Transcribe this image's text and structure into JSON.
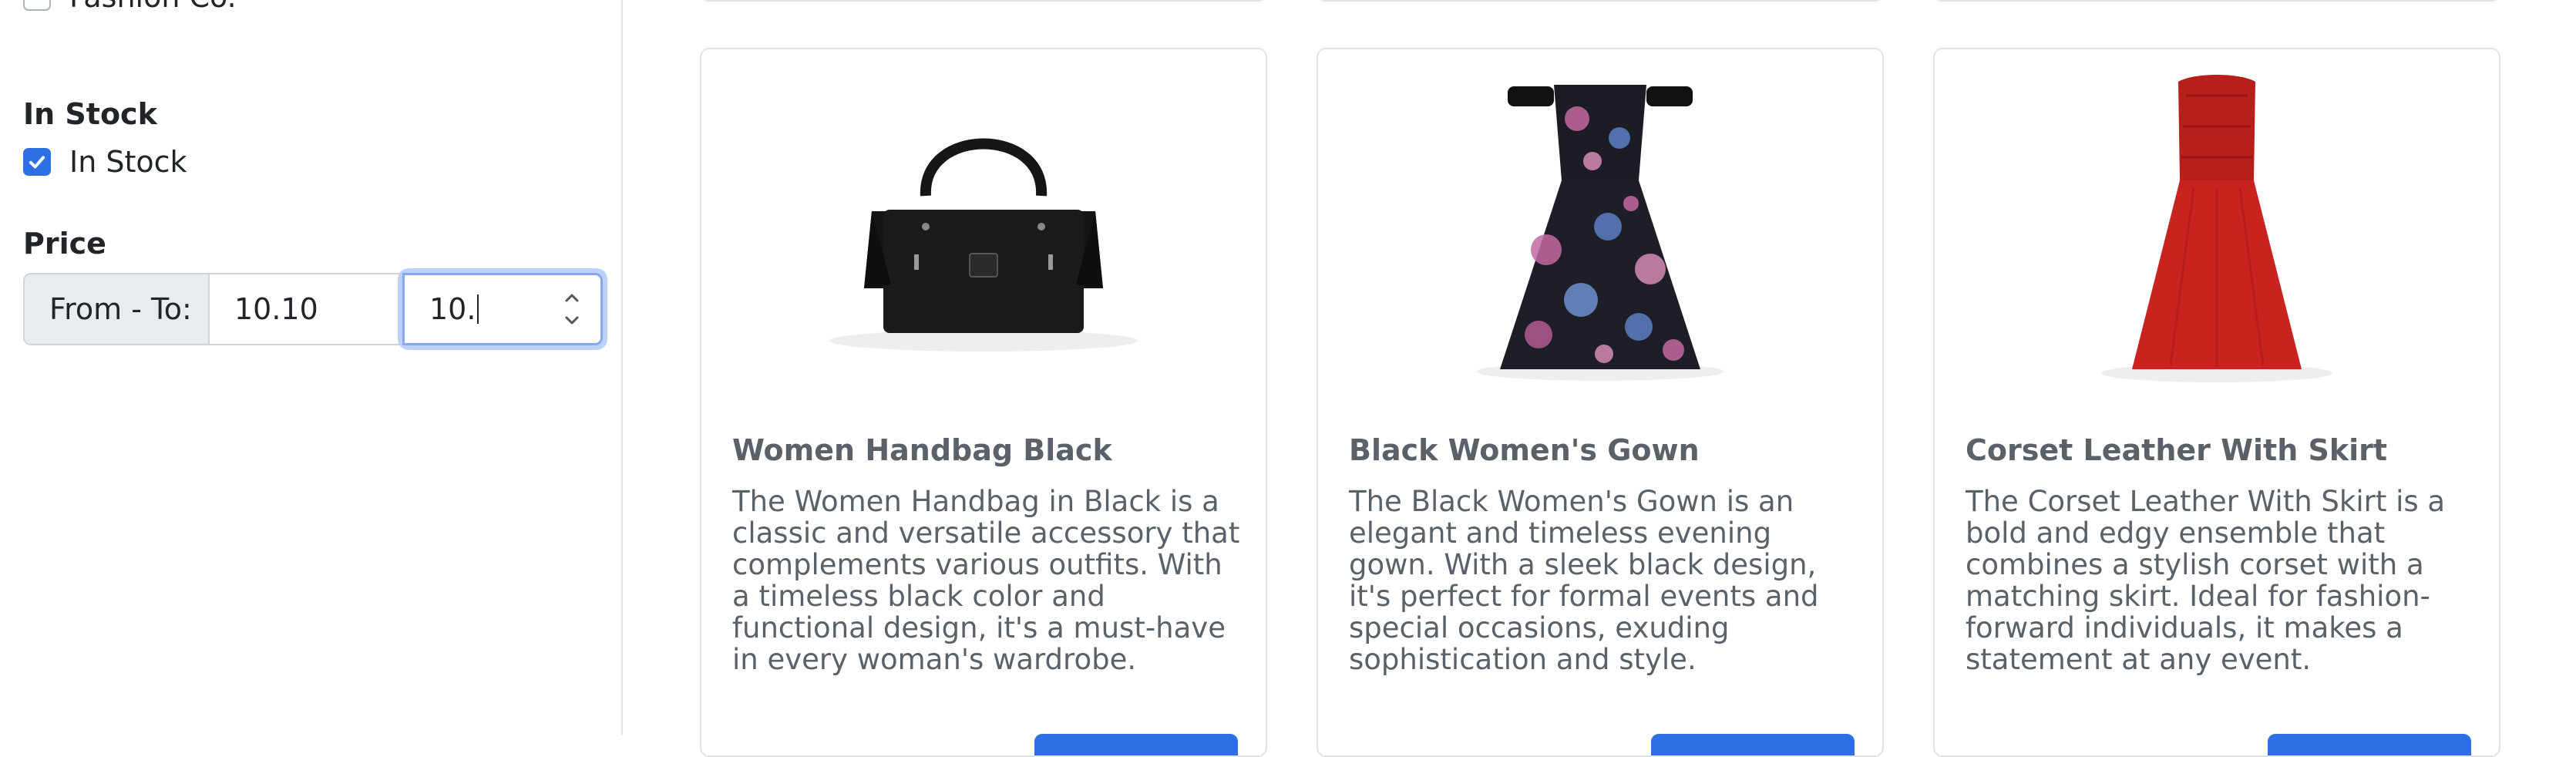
{
  "sidebar": {
    "brand_item": {
      "label": "Fashion Co.",
      "checked": false
    },
    "stock_section": {
      "title": "In Stock",
      "checkbox_label": "In Stock",
      "checked": true
    },
    "price_section": {
      "title": "Price",
      "prefix": "From - To:",
      "from_value": "10.10",
      "to_value": "10."
    }
  },
  "products": [
    {
      "title": "Women Handbag Black",
      "description": "The Women Handbag in Black is a classic and versatile accessory that complements various outfits. With a timeless black color and functional design, it's a must-have in every woman's wardrobe.",
      "image_icon": "handbag-image"
    },
    {
      "title": "Black Women's Gown",
      "description": "The Black Women's Gown is an elegant and timeless evening gown. With a sleek black design, it's perfect for formal events and special occasions, exuding sophistication and style.",
      "image_icon": "gown-image"
    },
    {
      "title": "Corset Leather With Skirt",
      "description": "The Corset Leather With Skirt is a bold and edgy ensemble that combines a stylish corset with a matching skirt. Ideal for fashion-forward individuals, it makes a statement at any event.",
      "image_icon": "red-dress-image"
    }
  ],
  "colors": {
    "accent": "#2f6fe4",
    "focus_ring": "#bcd1f5",
    "muted_text": "#5b6168",
    "border": "#dfe2e6"
  }
}
